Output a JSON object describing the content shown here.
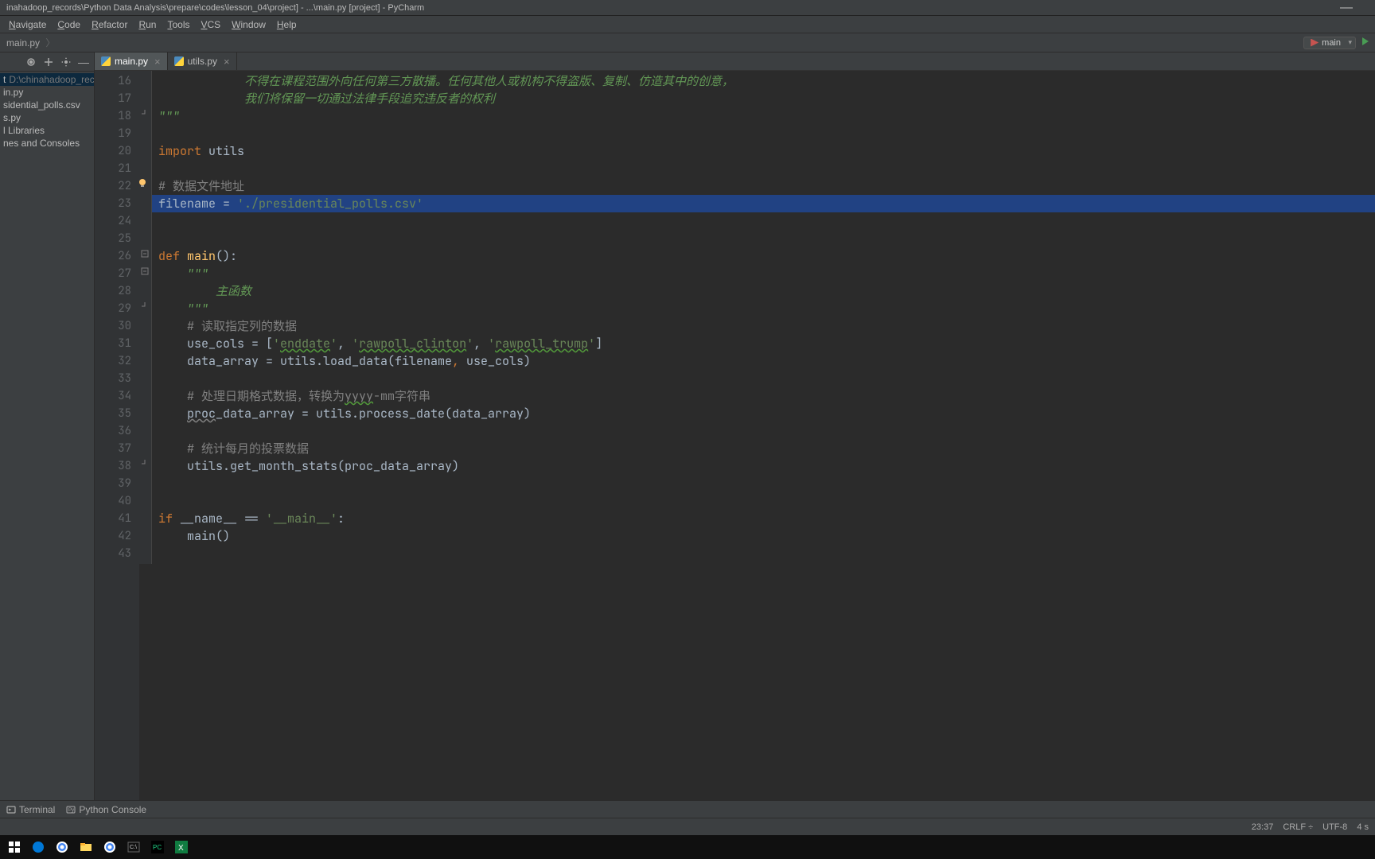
{
  "window": {
    "title": "inahadoop_records\\Python Data Analysis\\prepare\\codes\\lesson_04\\project] - ...\\main.py [project] - PyCharm"
  },
  "menubar": [
    "Navigate",
    "Code",
    "Refactor",
    "Run",
    "Tools",
    "VCS",
    "Window",
    "Help"
  ],
  "breadcrumb": [
    "main.py"
  ],
  "run_config": "main",
  "tabs": [
    {
      "label": "main.py",
      "active": true
    },
    {
      "label": "utils.py",
      "active": false
    }
  ],
  "project_tree": [
    {
      "label": "t",
      "path": "D:\\chinahadoop_records\\",
      "selected": true
    },
    {
      "label": "in.py"
    },
    {
      "label": "sidential_polls.csv"
    },
    {
      "label": "s.py"
    },
    {
      "label": "l Libraries"
    },
    {
      "label": "nes and Consoles"
    }
  ],
  "code_lines": [
    {
      "n": 16,
      "seg": [
        {
          "t": "            不得在课程范围外向任何第三方散播。任何其他人或机构不得盗版、复制、仿造其中的创意，",
          "c": "doccmt"
        }
      ]
    },
    {
      "n": 17,
      "seg": [
        {
          "t": "            我们将保留一切通过法律手段追究违反者的权利",
          "c": "doccmt"
        }
      ]
    },
    {
      "n": 18,
      "fold": "end",
      "seg": [
        {
          "t": "\"\"\"",
          "c": "doccmt"
        }
      ]
    },
    {
      "n": 19,
      "seg": []
    },
    {
      "n": 20,
      "seg": [
        {
          "t": "import ",
          "c": "kw"
        },
        {
          "t": "utils",
          "c": "param"
        }
      ]
    },
    {
      "n": 21,
      "seg": []
    },
    {
      "n": 22,
      "bulb": true,
      "seg": [
        {
          "t": "# ",
          "c": "cmt"
        },
        {
          "t": "数据文件地址",
          "c": "cmt"
        }
      ]
    },
    {
      "n": 23,
      "highlighted": true,
      "seg": [
        {
          "t": "filename = ",
          "c": "op"
        },
        {
          "t": "'./presidential_polls.csv'",
          "c": "str"
        }
      ]
    },
    {
      "n": 24,
      "seg": []
    },
    {
      "n": 25,
      "seg": []
    },
    {
      "n": 26,
      "fold": "start",
      "seg": [
        {
          "t": "def ",
          "c": "kw"
        },
        {
          "t": "main",
          "c": "fn"
        },
        {
          "t": "():",
          "c": "op"
        }
      ]
    },
    {
      "n": 27,
      "fold": "start",
      "seg": [
        {
          "t": "    \"\"\"",
          "c": "doccmt"
        }
      ]
    },
    {
      "n": 28,
      "seg": [
        {
          "t": "        主函数",
          "c": "doccmt"
        }
      ]
    },
    {
      "n": 29,
      "fold": "end",
      "seg": [
        {
          "t": "    \"\"\"",
          "c": "doccmt"
        }
      ]
    },
    {
      "n": 30,
      "seg": [
        {
          "t": "    ",
          "c": "op"
        },
        {
          "t": "# 读取指定列的数据",
          "c": "cmt"
        }
      ]
    },
    {
      "n": 31,
      "seg": [
        {
          "t": "    use_cols = [",
          "c": "op"
        },
        {
          "t": "'",
          "c": "str"
        },
        {
          "t": "enddate",
          "c": "str typo"
        },
        {
          "t": "'",
          "c": "str"
        },
        {
          "t": ", ",
          "c": "op"
        },
        {
          "t": "'",
          "c": "str"
        },
        {
          "t": "rawpoll_clinton",
          "c": "str typo"
        },
        {
          "t": "'",
          "c": "str"
        },
        {
          "t": ", ",
          "c": "op"
        },
        {
          "t": "'",
          "c": "str"
        },
        {
          "t": "rawpoll_trump",
          "c": "str typo"
        },
        {
          "t": "'",
          "c": "str"
        },
        {
          "t": "]",
          "c": "op"
        }
      ]
    },
    {
      "n": 32,
      "seg": [
        {
          "t": "    data_array = utils.load_data(filename",
          "c": "op"
        },
        {
          "t": ",",
          "c": "kw"
        },
        {
          "t": " use_cols)",
          "c": "op"
        }
      ]
    },
    {
      "n": 33,
      "seg": []
    },
    {
      "n": 34,
      "seg": [
        {
          "t": "    ",
          "c": "op"
        },
        {
          "t": "# 处理日期格式数据，转换为",
          "c": "cmt"
        },
        {
          "t": "yyyy",
          "c": "cmt typo"
        },
        {
          "t": "-mm字符串",
          "c": "cmt"
        }
      ]
    },
    {
      "n": 35,
      "seg": [
        {
          "t": "    ",
          "c": "op"
        },
        {
          "t": "proc",
          "c": "op underlined"
        },
        {
          "t": "_data_array = utils.process_date(data_array)",
          "c": "op"
        }
      ]
    },
    {
      "n": 36,
      "seg": []
    },
    {
      "n": 37,
      "seg": [
        {
          "t": "    ",
          "c": "op"
        },
        {
          "t": "# 统计每月的投票数据",
          "c": "cmt"
        }
      ]
    },
    {
      "n": 38,
      "fold": "end",
      "seg": [
        {
          "t": "    utils.get_month_stats(proc_data_array)",
          "c": "op"
        }
      ]
    },
    {
      "n": 39,
      "seg": []
    },
    {
      "n": 40,
      "seg": []
    },
    {
      "n": 41,
      "run": true,
      "seg": [
        {
          "t": "if ",
          "c": "kw"
        },
        {
          "t": "__name__ == ",
          "c": "op"
        },
        {
          "t": "'__main__'",
          "c": "str"
        },
        {
          "t": ":",
          "c": "op"
        }
      ]
    },
    {
      "n": 42,
      "seg": [
        {
          "t": "    main()",
          "c": "op"
        }
      ]
    },
    {
      "n": 43,
      "seg": []
    }
  ],
  "bottom_tools": [
    "Terminal",
    "Python Console"
  ],
  "status": {
    "pos": "23:37",
    "sep": "CRLF ÷",
    "enc": "UTF-8",
    "spaces": "4 s"
  },
  "taskbar_icons": [
    "windows",
    "edge",
    "chrome",
    "file-explorer",
    "chrome2",
    "cmd",
    "pycharm",
    "excel"
  ]
}
